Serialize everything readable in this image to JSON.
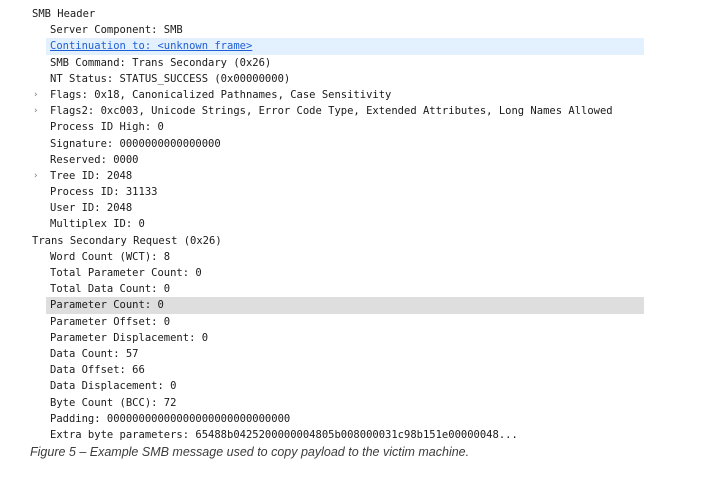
{
  "tree": {
    "rows": [
      {
        "text": "SMB Header",
        "level": 0
      },
      {
        "text": "Server Component: SMB",
        "level": 1
      },
      {
        "text": "Continuation to: <unknown frame>",
        "level": 1,
        "link": true,
        "highlight": "blue"
      },
      {
        "text": "SMB Command: Trans Secondary (0x26)",
        "level": 1
      },
      {
        "text": "NT Status: STATUS_SUCCESS (0x00000000)",
        "level": 1
      },
      {
        "text": "Flags: 0x18, Canonicalized Pathnames, Case Sensitivity",
        "level": 1,
        "expandable": true
      },
      {
        "text": "Flags2: 0xc003, Unicode Strings, Error Code Type, Extended Attributes, Long Names Allowed",
        "level": 1,
        "expandable": true
      },
      {
        "text": "Process ID High: 0",
        "level": 1
      },
      {
        "text": "Signature: 0000000000000000",
        "level": 1
      },
      {
        "text": "Reserved: 0000",
        "level": 1
      },
      {
        "text": "Tree ID: 2048",
        "level": 1,
        "expandable": true
      },
      {
        "text": "Process ID: 31133",
        "level": 1
      },
      {
        "text": "User ID: 2048",
        "level": 1
      },
      {
        "text": "Multiplex ID: 0",
        "level": 1
      },
      {
        "text": "Trans Secondary Request (0x26)",
        "level": 0
      },
      {
        "text": "Word Count (WCT): 8",
        "level": 1
      },
      {
        "text": "Total Parameter Count: 0",
        "level": 1
      },
      {
        "text": "Total Data Count: 0",
        "level": 1
      },
      {
        "text": "Parameter Count: 0",
        "level": 1,
        "highlight": "gray"
      },
      {
        "text": "Parameter Offset: 0",
        "level": 1
      },
      {
        "text": "Parameter Displacement: 0",
        "level": 1
      },
      {
        "text": "Data Count: 57",
        "level": 1
      },
      {
        "text": "Data Offset: 66",
        "level": 1
      },
      {
        "text": "Data Displacement: 0",
        "level": 1
      },
      {
        "text": "Byte Count (BCC): 72",
        "level": 1
      },
      {
        "text": "Padding: 00000000000000000000000000000",
        "level": 1
      },
      {
        "text": "Extra byte parameters: 65488b0425200000004805b008000031c98b151e00000048...",
        "level": 1
      }
    ],
    "expand_icon": "chevron-right-icon",
    "colors": {
      "link": "#1f5fd6",
      "selection_blue": "#e3f0fd",
      "selection_gray": "#dedede"
    }
  },
  "caption": "Figure 5 – Example SMB message used to copy payload to the victim machine."
}
